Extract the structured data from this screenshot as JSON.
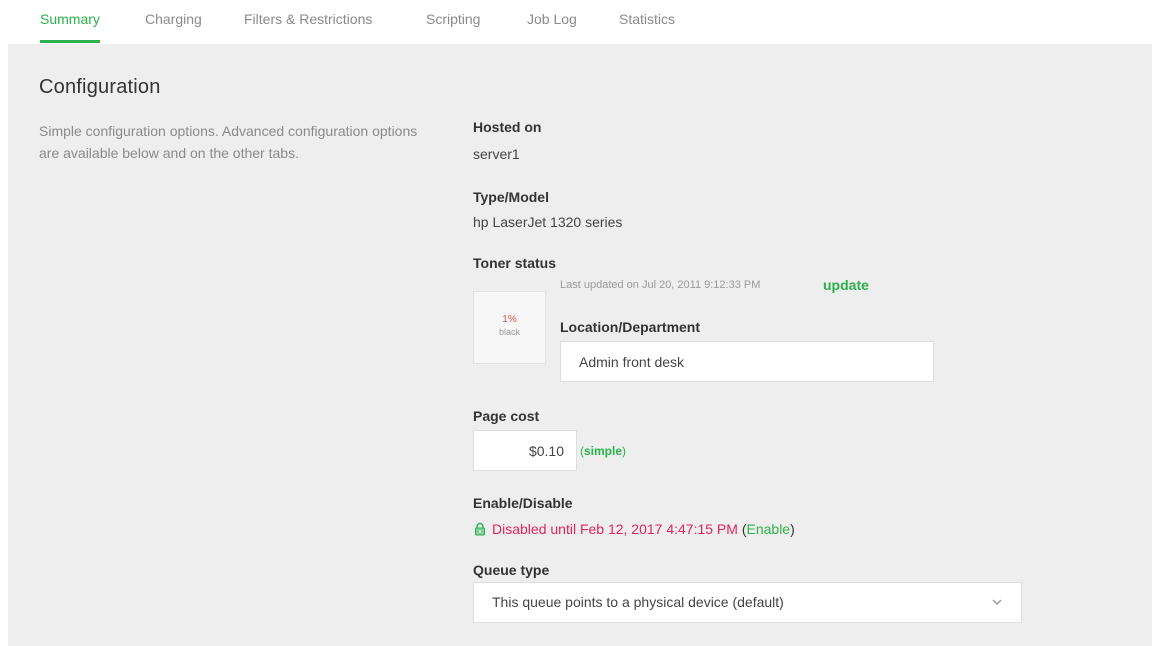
{
  "tabs": [
    {
      "label": "Summary",
      "active": true
    },
    {
      "label": "Charging",
      "active": false
    },
    {
      "label": "Filters & Restrictions",
      "active": false
    },
    {
      "label": "Scripting",
      "active": false
    },
    {
      "label": "Job Log",
      "active": false
    },
    {
      "label": "Statistics",
      "active": false
    }
  ],
  "section": {
    "title": "Configuration",
    "description": "Simple configuration options. Advanced configuration options are available below and on the other tabs."
  },
  "hosted_on": {
    "label": "Hosted on",
    "value": "server1"
  },
  "type_model": {
    "label": "Type/Model",
    "value": "hp LaserJet 1320 series"
  },
  "toner": {
    "label": "Toner status",
    "percent": "1%",
    "color_name": "black",
    "last_updated": "Last updated on Jul 20, 2011 9:12:33 PM",
    "update_label": "update"
  },
  "location": {
    "label": "Location/Department",
    "value": "Admin front desk"
  },
  "page_cost": {
    "label": "Page cost",
    "value": "$0.10",
    "mode_open": "(",
    "mode_label": "simple",
    "mode_close": ")"
  },
  "enable_disable": {
    "label": "Enable/Disable",
    "status": "Disabled until Feb 12, 2017 4:47:15 PM",
    "open_paren": " (",
    "enable_label": "Enable",
    "close_paren": ")"
  },
  "queue_type": {
    "label": "Queue type",
    "selected": "This queue points to a physical device (default)"
  },
  "colors": {
    "accent": "#2bb24c",
    "disabled": "#e0245e",
    "panel_bg": "#eeeeee"
  },
  "icons": {
    "lock": "lock-icon",
    "dropdown": "chevron-down-icon"
  }
}
